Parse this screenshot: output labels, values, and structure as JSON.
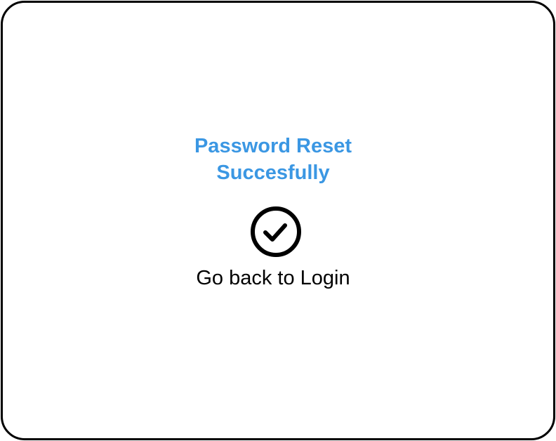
{
  "dialog": {
    "title_line1": "Password Reset",
    "title_line2": "Succesfully",
    "icon": "check-circle-icon",
    "back_link_label": "Go back to Login",
    "accent_color": "#3b97e3"
  }
}
